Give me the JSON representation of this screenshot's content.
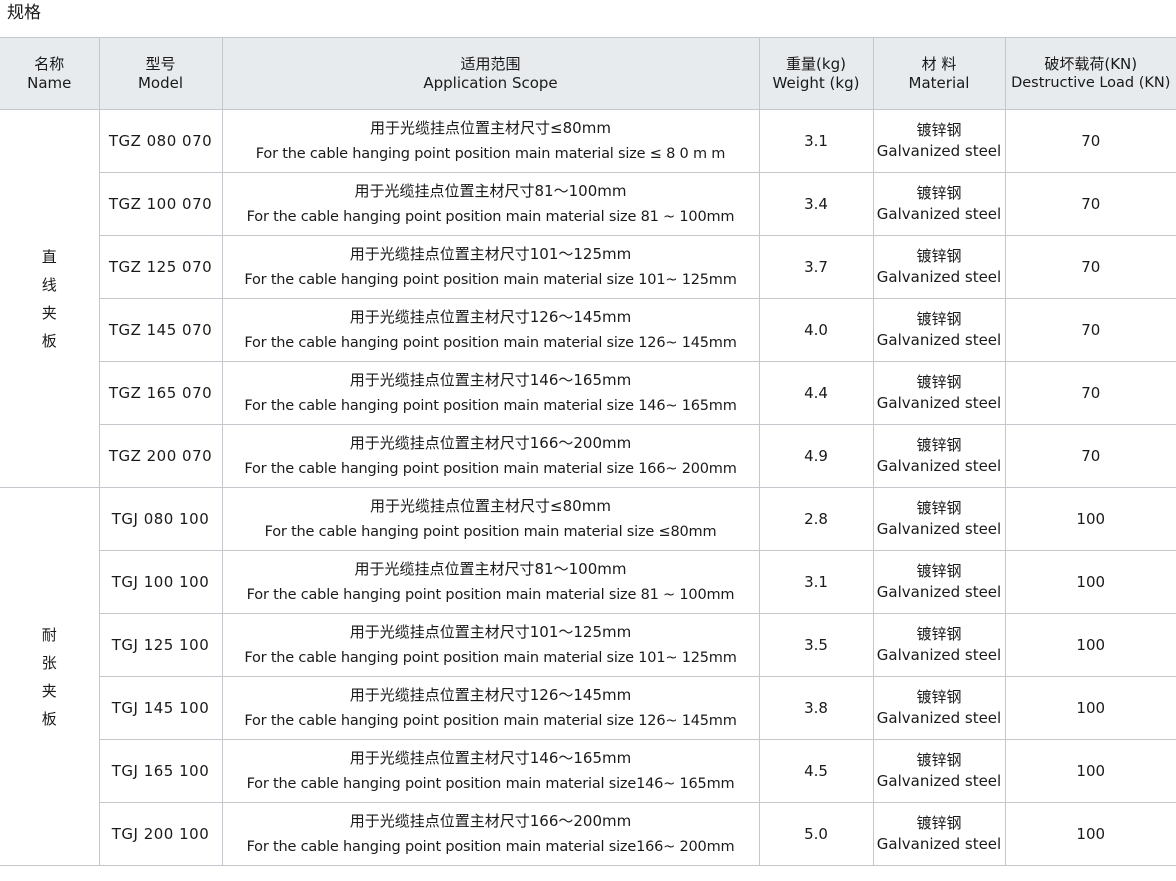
{
  "page_title": "规格",
  "headers": {
    "name": {
      "zh": "名称",
      "en": "Name"
    },
    "model": {
      "zh": "型号",
      "en": "Model"
    },
    "scope": {
      "zh": "适用范围",
      "en": "Application Scope"
    },
    "weight": {
      "zh": "重量(kg)",
      "en": "Weight (kg)"
    },
    "material": {
      "zh": "材 料",
      "en": "Material"
    },
    "load": {
      "zh": "破坏载荷(KN)",
      "en": "Destructive Load (KN)"
    }
  },
  "groups": [
    {
      "category_chars": [
        "直",
        "线",
        "夹",
        "板"
      ],
      "rows": [
        {
          "model": "TGZ 080 070",
          "scope_zh": "用于光缆挂点位置主材尺寸≤80mm",
          "scope_en": "For the cable hanging point position main material size ≤ 8 0 m m",
          "weight": "3.1",
          "material_zh": "镀锌钢",
          "material_en": "Galvanized steel",
          "load": "70"
        },
        {
          "model": "TGZ 100 070",
          "scope_zh": "用于光缆挂点位置主材尺寸81～100mm",
          "scope_en": "For the cable hanging point position main material size 81 ~ 100mm",
          "weight": "3.4",
          "material_zh": "镀锌钢",
          "material_en": "Galvanized steel",
          "load": "70"
        },
        {
          "model": "TGZ 125 070",
          "scope_zh": "用于光缆挂点位置主材尺寸101～125mm",
          "scope_en": "For the cable hanging point position main material size 101~ 125mm",
          "weight": "3.7",
          "material_zh": "镀锌钢",
          "material_en": "Galvanized steel",
          "load": "70"
        },
        {
          "model": "TGZ 145 070",
          "scope_zh": "用于光缆挂点位置主材尺寸126～145mm",
          "scope_en": "For the cable hanging point position main material size 126~ 145mm",
          "weight": "4.0",
          "material_zh": "镀锌钢",
          "material_en": "Galvanized steel",
          "load": "70"
        },
        {
          "model": "TGZ 165 070",
          "scope_zh": "用于光缆挂点位置主材尺寸146～165mm",
          "scope_en": "For the cable hanging point position main material size 146~ 165mm",
          "weight": "4.4",
          "material_zh": "镀锌钢",
          "material_en": "Galvanized steel",
          "load": "70"
        },
        {
          "model": "TGZ 200 070",
          "scope_zh": "用于光缆挂点位置主材尺寸166～200mm",
          "scope_en": "For the cable hanging point position main material size 166~ 200mm",
          "weight": "4.9",
          "material_zh": "镀锌钢",
          "material_en": "Galvanized steel",
          "load": "70"
        }
      ]
    },
    {
      "category_chars": [
        "耐",
        "张",
        "夹",
        "板"
      ],
      "rows": [
        {
          "model": "TGJ 080 100",
          "scope_zh": "用于光缆挂点位置主材尺寸≤80mm",
          "scope_en": "For the cable hanging point position main material size ≤80mm",
          "weight": "2.8",
          "material_zh": "镀锌钢",
          "material_en": "Galvanized steel",
          "load": "100"
        },
        {
          "model": "TGJ 100 100",
          "scope_zh": "用于光缆挂点位置主材尺寸81～100mm",
          "scope_en": "For the cable hanging point position main material size 81 ~ 100mm",
          "weight": "3.1",
          "material_zh": "镀锌钢",
          "material_en": "Galvanized steel",
          "load": "100"
        },
        {
          "model": "TGJ 125 100",
          "scope_zh": "用于光缆挂点位置主材尺寸101～125mm",
          "scope_en": "For the cable hanging point position main material size 101~ 125mm",
          "weight": "3.5",
          "material_zh": "镀锌钢",
          "material_en": "Galvanized steel",
          "load": "100"
        },
        {
          "model": "TGJ 145 100",
          "scope_zh": "用于光缆挂点位置主材尺寸126～145mm",
          "scope_en": "For the cable hanging point position main material size 126~ 145mm",
          "weight": "3.8",
          "material_zh": "镀锌钢",
          "material_en": "Galvanized steel",
          "load": "100"
        },
        {
          "model": "TGJ 165 100",
          "scope_zh": "用于光缆挂点位置主材尺寸146～165mm",
          "scope_en": "For the cable hanging point position main material size146~ 165mm",
          "weight": "4.5",
          "material_zh": "镀锌钢",
          "material_en": "Galvanized steel",
          "load": "100"
        },
        {
          "model": "TGJ 200 100",
          "scope_zh": "用于光缆挂点位置主材尺寸166～200mm",
          "scope_en": "For the cable hanging point position main material size166~ 200mm",
          "weight": "5.0",
          "material_zh": "镀锌钢",
          "material_en": "Galvanized steel",
          "load": "100"
        }
      ]
    }
  ]
}
